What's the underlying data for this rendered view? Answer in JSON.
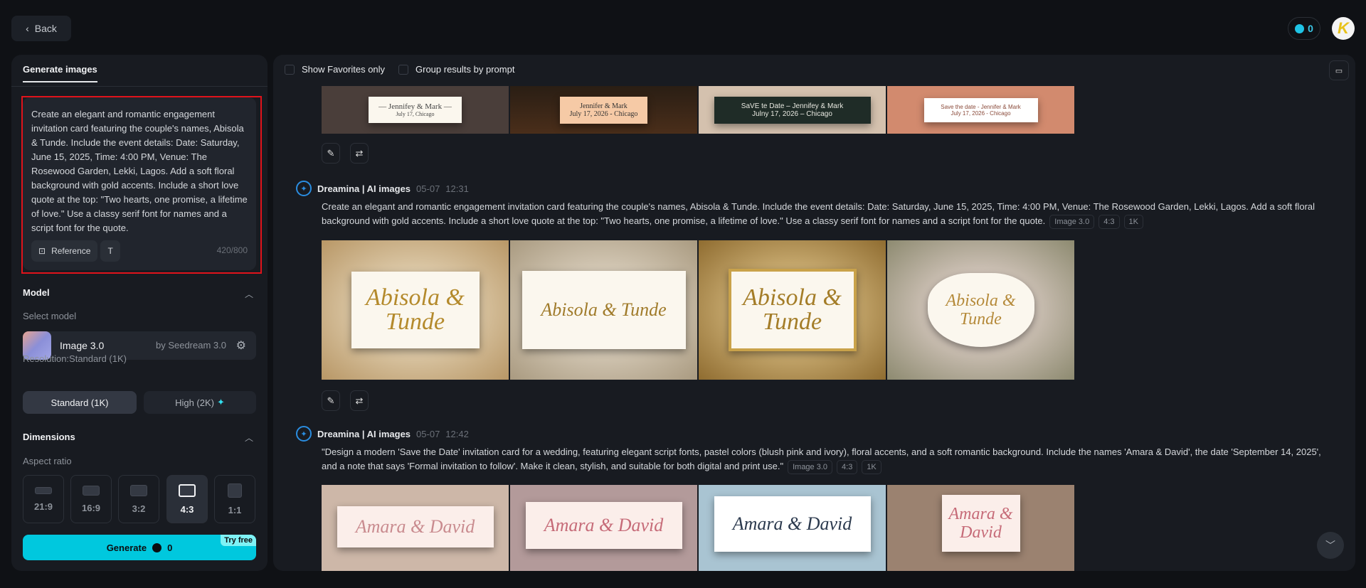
{
  "header": {
    "back_label": "Back",
    "credits": "0",
    "avatar_letter": "K"
  },
  "sidebar": {
    "tab": "Generate images",
    "prompt": "Create an elegant and romantic engagement invitation card featuring the couple's names, Abisola & Tunde. Include the event details: Date: Saturday, June 15, 2025, Time: 4:00 PM, Venue: The Rosewood Garden, Lekki, Lagos. Add a soft floral background with gold accents. Include a short love quote at the top: \"Two hearts, one promise, a lifetime of love.\" Use a classy serif font for names and a script font for the quote.",
    "reference_label": "Reference",
    "char_count": "420/800",
    "model_heading": "Model",
    "select_model": "Select model",
    "model_name": "Image 3.0",
    "model_by": "by Seedream 3.0",
    "resolution_label": "Resolution:Standard (1K)",
    "res_standard": "Standard (1K)",
    "res_high": "High (2K)",
    "dimensions_heading": "Dimensions",
    "aspect_label": "Aspect ratio",
    "ratios": [
      "21:9",
      "16:9",
      "3:2",
      "4:3",
      "1:1"
    ],
    "selected_ratio": "4:3",
    "generate_label": "Generate",
    "generate_cost": "0",
    "try_free": "Try free"
  },
  "main": {
    "show_favorites": "Show Favorites only",
    "group_by_prompt": "Group results by prompt",
    "group1": {
      "images": [
        {
          "l1": "— Jennifey & Mark —",
          "l2": "July 17, Chicago"
        },
        {
          "l1": "Jennifer & Mark",
          "l2": "July 17, 2026 - Chicago"
        },
        {
          "l1": "SaVE te Date – Jennifey & Mark",
          "l2": "Julny 17, 2026 – Chicago"
        },
        {
          "l1": "Save the date - Jennifer & Mark",
          "l2": "July 17, 2026 - Chicago"
        }
      ]
    },
    "group2": {
      "author": "Dreamina | AI images",
      "date": "05-07",
      "time": "12:31",
      "prompt": "Create an elegant and romantic engagement invitation card featuring the couple's names, Abisola & Tunde. Include the event details: Date: Saturday, June 15, 2025, Time: 4:00 PM, Venue: The Rosewood Garden, Lekki, Lagos. Add a soft floral background with gold accents. Include a short love quote at the top: \"Two hearts, one promise, a lifetime of love.\" Use a classy serif font for names and a script font for the quote.",
      "tags": [
        "Image 3.0",
        "4:3",
        "1K"
      ],
      "images": [
        {
          "l1": "Abisola & Tunde"
        },
        {
          "l1": "Abisola & Tunde"
        },
        {
          "l1": "Abisola & Tunde"
        },
        {
          "l1": "Abisola & Tunde"
        }
      ]
    },
    "group3": {
      "author": "Dreamina | AI images",
      "date": "05-07",
      "time": "12:42",
      "prompt": "\"Design a modern 'Save the Date' invitation card for a wedding, featuring elegant script fonts, pastel colors (blush pink and ivory), floral accents, and a soft romantic background. Include the names 'Amara & David', the date 'September 14, 2025', and a note that says 'Formal invitation to follow'. Make it clean, stylish, and suitable for both digital and print use.\"",
      "tags": [
        "Image 3.0",
        "4:3",
        "1K"
      ],
      "images": [
        {
          "l1": "Amara & David"
        },
        {
          "l1": "Amara & David"
        },
        {
          "l1": "Amara & David"
        },
        {
          "l1": "Amara & David"
        }
      ]
    }
  }
}
